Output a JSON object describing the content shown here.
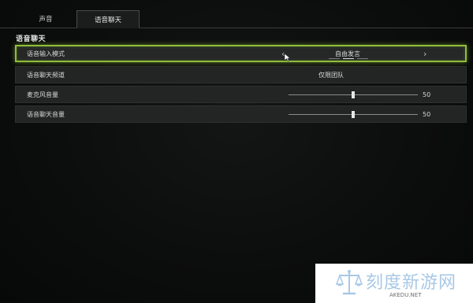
{
  "tabs": [
    {
      "label": "声音",
      "active": false
    },
    {
      "label": "语音聊天",
      "active": true
    }
  ],
  "section": {
    "title": "语音聊天"
  },
  "rows": [
    {
      "label": "语音输入模式",
      "value": "自由发言",
      "type": "selector",
      "selected": true,
      "option_count": 3,
      "option_index": 1
    },
    {
      "label": "语音聊天频道",
      "value": "仅限团队",
      "type": "text"
    },
    {
      "label": "麦克风音量",
      "value": "50",
      "type": "slider",
      "level_percent": 50
    },
    {
      "label": "语音聊天音量",
      "value": "50",
      "type": "slider",
      "level_percent": 50
    }
  ],
  "watermark": {
    "text": "刻度新游网",
    "sub": "AKEDU.NET"
  },
  "colors": {
    "background": "#0b0c0c",
    "row_bg": "#232424",
    "selected_border": "#8fbf3a",
    "text": "#d6d6d6",
    "watermark_text": "#a8c8e6"
  }
}
